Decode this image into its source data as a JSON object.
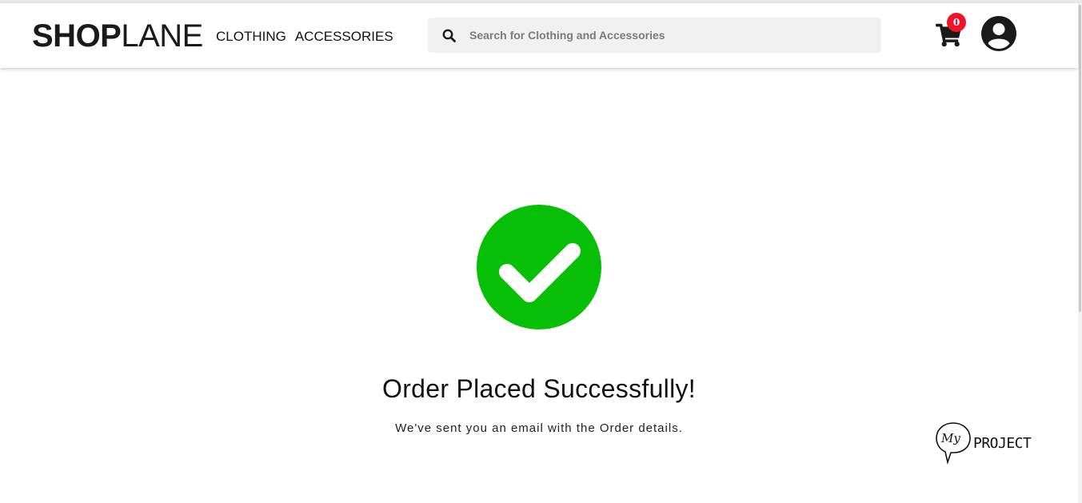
{
  "brand": {
    "bold": "SHOP",
    "light": "LANE"
  },
  "nav": {
    "clothing": "CLOTHING",
    "accessories": "ACCESSORIES"
  },
  "search": {
    "placeholder": "Search for Clothing and Accessories",
    "value": ""
  },
  "cart": {
    "count": "0"
  },
  "main": {
    "title": "Order Placed Successfully!",
    "subtitle": "We've sent you an email with the Order details."
  },
  "watermark": {
    "logo_script": "My",
    "label": "PROJECT"
  },
  "icons": {
    "search": "search-icon",
    "cart": "shopping-cart-icon",
    "user": "user-circle-icon",
    "success": "check-circle-icon"
  },
  "colors": {
    "success_green": "#06bf06",
    "badge_red": "#f0132b",
    "text_dark": "#1a1a1a"
  }
}
